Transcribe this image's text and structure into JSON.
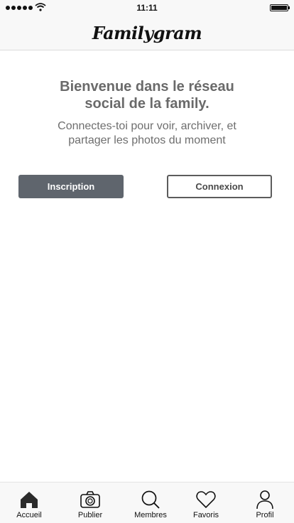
{
  "status_bar": {
    "time": "11:11"
  },
  "header": {
    "logo": "Familygram"
  },
  "welcome": {
    "title": "Bienvenue dans le réseau social de la family.",
    "subtitle": "Connectes-toi pour voir, archiver, et partager les photos du moment"
  },
  "actions": {
    "signup_label": "Inscription",
    "login_label": "Connexion"
  },
  "tabs": [
    {
      "label": "Accueil",
      "icon": "home-icon",
      "active": true
    },
    {
      "label": "Publier",
      "icon": "camera-icon"
    },
    {
      "label": "Membres",
      "icon": "search-icon"
    },
    {
      "label": "Favoris",
      "icon": "heart-icon"
    },
    {
      "label": "Profil",
      "icon": "user-icon"
    }
  ]
}
